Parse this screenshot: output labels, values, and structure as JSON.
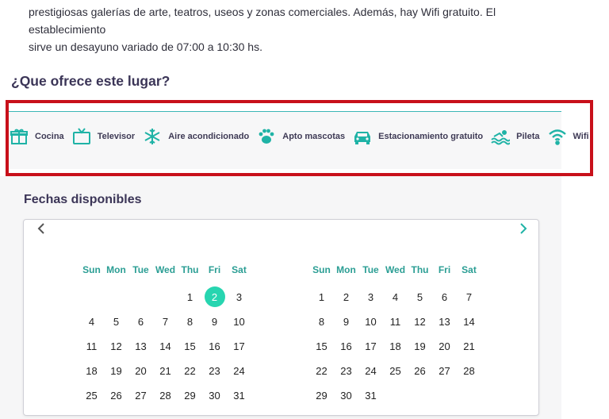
{
  "description": {
    "line1": "prestigiosas galerías de arte, teatros, useos y zonas comerciales. Además, hay Wifi gratuito. El establecimiento",
    "line2": "sirve un desayuno variado de 07:00 a 10:30 hs."
  },
  "amenities_section": {
    "title": "¿Que ofrece este lugar?",
    "items": [
      {
        "label": "Cocina",
        "icon": "gift-box-icon"
      },
      {
        "label": "Televisor",
        "icon": "tv-icon"
      },
      {
        "label": "Aire acondicionado",
        "icon": "snowflake-icon"
      },
      {
        "label": "Apto mascotas",
        "icon": "paw-icon"
      },
      {
        "label": "Estacionamiento gratuito",
        "icon": "car-icon"
      },
      {
        "label": "Pileta",
        "icon": "swimmer-icon"
      },
      {
        "label": "Wifi",
        "icon": "wifi-icon"
      }
    ],
    "icon_color": "#1fb3a6",
    "highlight_color": "#c8101a"
  },
  "availability": {
    "title": "Fechas disponibles",
    "weekdays": [
      "Sun",
      "Mon",
      "Tue",
      "Wed",
      "Thu",
      "Fri",
      "Sat"
    ],
    "selected_color": "#27d5b0",
    "months": [
      {
        "weeks": [
          [
            "",
            "",
            "",
            "",
            "1",
            "2",
            "3"
          ],
          [
            "4",
            "5",
            "6",
            "7",
            "8",
            "9",
            "10"
          ],
          [
            "11",
            "12",
            "13",
            "14",
            "15",
            "16",
            "17"
          ],
          [
            "18",
            "19",
            "20",
            "21",
            "22",
            "23",
            "24"
          ],
          [
            "25",
            "26",
            "27",
            "28",
            "29",
            "30",
            "31"
          ]
        ],
        "selected_day": "2"
      },
      {
        "weeks": [
          [
            "",
            "1",
            "2",
            "3",
            "4",
            "5",
            "6",
            "7"
          ],
          [
            "",
            "8",
            "9",
            "10",
            "11",
            "12",
            "13",
            "14"
          ],
          [
            "",
            "15",
            "16",
            "17",
            "18",
            "19",
            "20",
            "21"
          ],
          [
            "",
            "22",
            "23",
            "24",
            "25",
            "26",
            "27",
            "28"
          ],
          [
            "",
            "29",
            "30",
            "31",
            "",
            "",
            "",
            ""
          ]
        ],
        "selected_day": ""
      }
    ]
  }
}
